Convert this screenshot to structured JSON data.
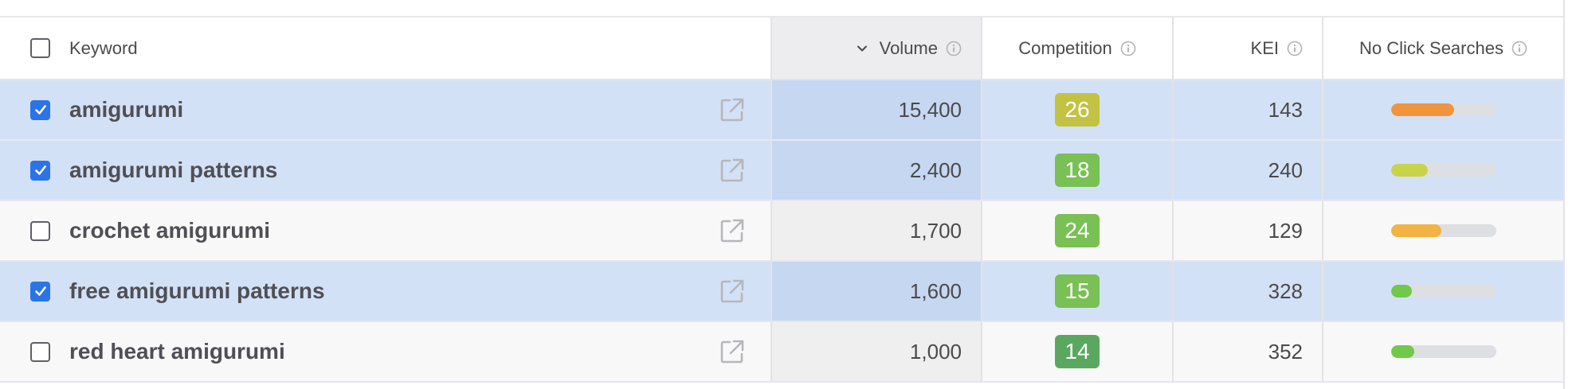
{
  "columns": {
    "keyword": "Keyword",
    "volume": "Volume",
    "competition": "Competition",
    "kei": "KEI",
    "no_click_searches": "No Click Searches"
  },
  "rows": [
    {
      "keyword": "amigurumi",
      "volume": "15,400",
      "competition": "26",
      "competition_color": "#c3c243",
      "kei": "143",
      "no_click_fraction": 0.6,
      "no_click_color": "#f0953d",
      "checked": true
    },
    {
      "keyword": "amigurumi patterns",
      "volume": "2,400",
      "competition": "18",
      "competition_color": "#79c055",
      "kei": "240",
      "no_click_fraction": 0.35,
      "no_click_color": "#c9d34a",
      "checked": true
    },
    {
      "keyword": "crochet amigurumi",
      "volume": "1,700",
      "competition": "24",
      "competition_color": "#79c055",
      "kei": "129",
      "no_click_fraction": 0.48,
      "no_click_color": "#f2b344",
      "checked": false
    },
    {
      "keyword": "free amigurumi patterns",
      "volume": "1,600",
      "competition": "15",
      "competition_color": "#79c055",
      "kei": "328",
      "no_click_fraction": 0.2,
      "no_click_color": "#70c94a",
      "checked": true
    },
    {
      "keyword": "red heart amigurumi",
      "volume": "1,000",
      "competition": "14",
      "competition_color": "#5aa860",
      "kei": "352",
      "no_click_fraction": 0.22,
      "no_click_color": "#70c94a",
      "checked": false
    }
  ],
  "icons": {
    "info": "info-icon",
    "sort": "chevron-down-icon",
    "external": "external-link-icon",
    "check": "checkmark-icon"
  },
  "colors": {
    "selected_row": "#d3e1f6",
    "checkbox_checked": "#2c74e6"
  }
}
